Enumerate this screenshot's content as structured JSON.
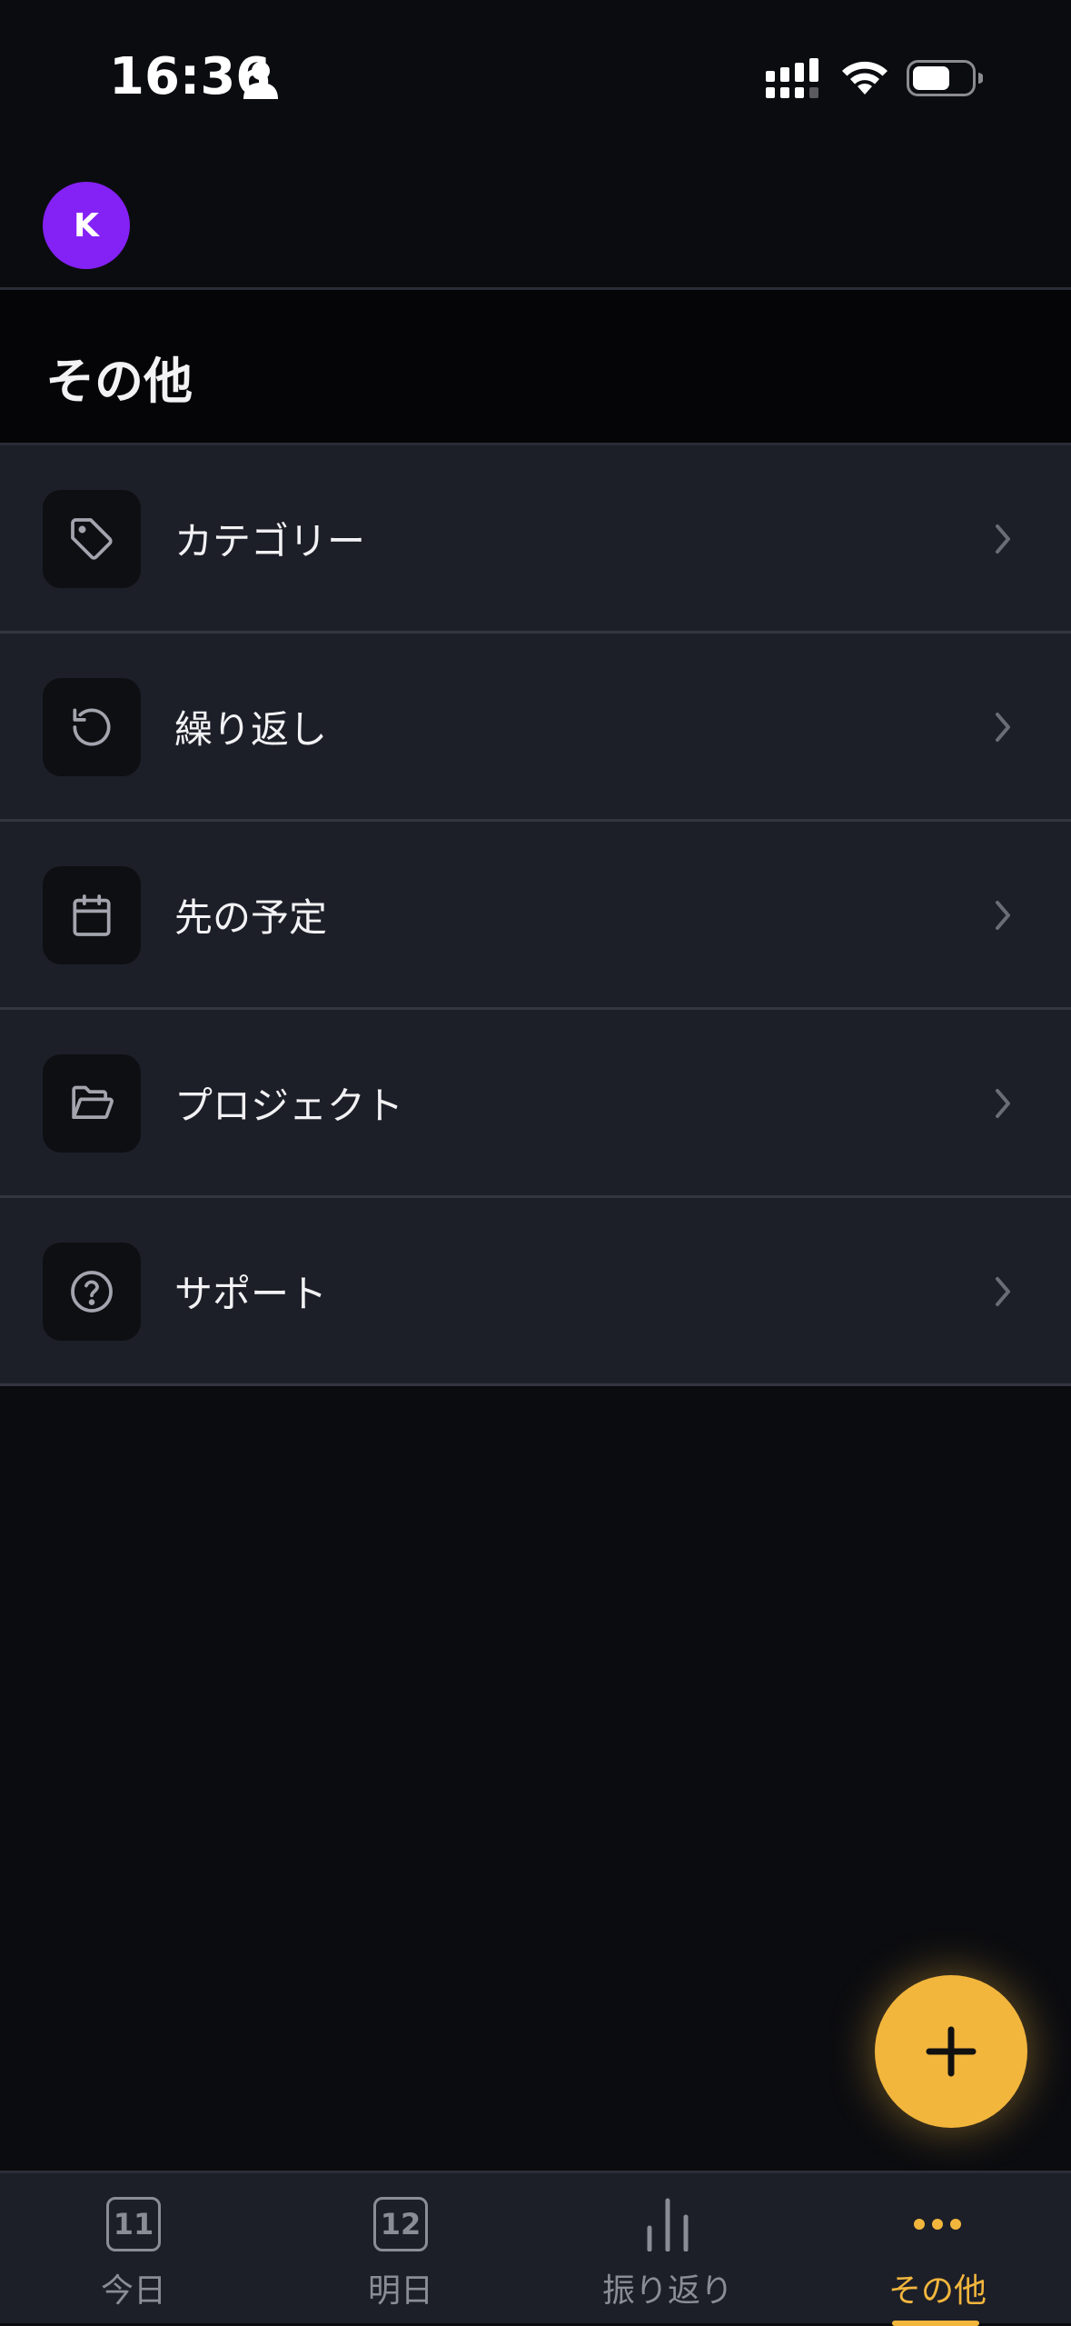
{
  "status_bar": {
    "time": "16:36"
  },
  "header": {
    "avatar_initial": "K"
  },
  "page": {
    "title": "その他"
  },
  "menu": {
    "items": [
      {
        "label": "カテゴリー",
        "icon": "tag-icon"
      },
      {
        "label": "繰り返し",
        "icon": "repeat-icon"
      },
      {
        "label": "先の予定",
        "icon": "calendar-icon"
      },
      {
        "label": "プロジェクト",
        "icon": "folder-open-icon"
      },
      {
        "label": "サポート",
        "icon": "help-circle-icon"
      }
    ]
  },
  "tabs": [
    {
      "label": "今日",
      "day": "11",
      "icon": "calendar-day-icon",
      "active": false
    },
    {
      "label": "明日",
      "day": "12",
      "icon": "calendar-day-icon",
      "active": false
    },
    {
      "label": "振り返り",
      "icon": "bar-chart-icon",
      "active": false
    },
    {
      "label": "その他",
      "icon": "more-dots-icon",
      "active": true
    }
  ],
  "colors": {
    "accent": "#f2b63d",
    "avatar": "#8421f5",
    "background": "#0b0c10",
    "list_item": "#1d1f28",
    "muted": "#8b8d96"
  }
}
